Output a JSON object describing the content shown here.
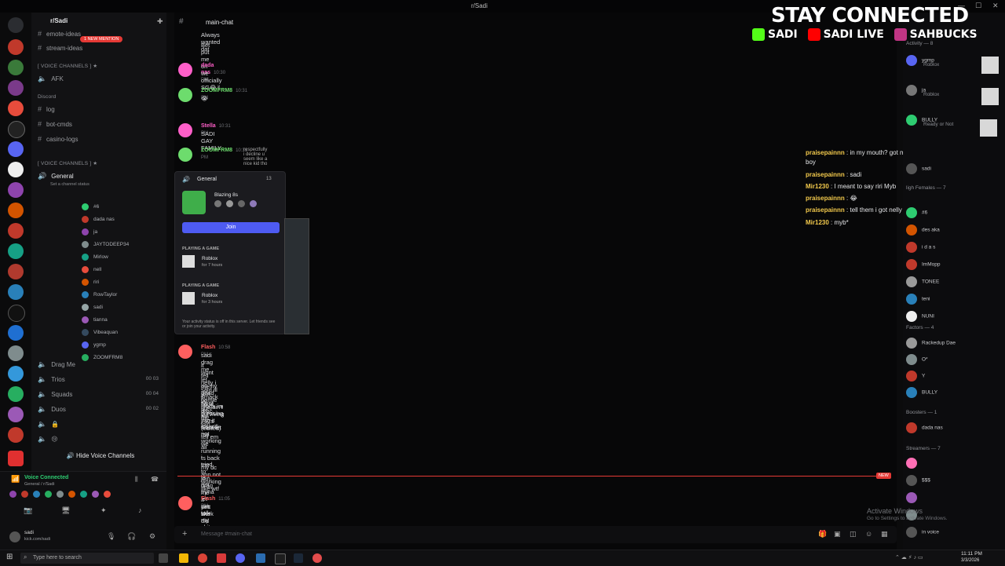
{
  "window": {
    "title": "r/Sadi"
  },
  "server": {
    "name": "r/Sadi"
  },
  "sidebar": {
    "mention_badge": "1 NEW MENTION",
    "top_channels": [
      "emote-ideas",
      "stream-ideas"
    ],
    "voice_category_1": "[ VOICE CHANNELS ] ★",
    "afk": "AFK",
    "discord_category": "Discord",
    "text_channels": [
      "log",
      "bot-cmds",
      "casino-logs"
    ],
    "voice_category_2": "[ VOICE CHANNELS ] ★",
    "general": "General",
    "status_hint": "Set a channel status",
    "members": [
      "#6",
      "dada nas",
      "ja",
      "JAYTODEEP34",
      "Mirlow",
      "nell",
      "riri",
      "RowTaylor",
      "sadi",
      "tianna",
      "Vibeaquan",
      "ygmp",
      "ZOOMFRM8"
    ],
    "voice_channels": [
      {
        "name": "Drag Me",
        "count": ""
      },
      {
        "name": "Trios",
        "count": "00 03"
      },
      {
        "name": "Squads",
        "count": "00 04"
      },
      {
        "name": "Duos",
        "count": "00 02"
      }
    ],
    "hide_voice": "Hide Voice Channels"
  },
  "voice_panel": {
    "status": "Voice Connected",
    "channel": "General / r/Sadi",
    "user": "sadi",
    "sub": "kick.com/sadi"
  },
  "chat": {
    "channel": "main-chat",
    "input_placeholder": "Message #main-chat",
    "messages": [
      {
        "author": "",
        "time": "",
        "lines": [
          "Always wanted dat",
          "Bet put me on"
        ],
        "color": "#dcdde0"
      },
      {
        "author": "dada nas",
        "time": "10:30 PM",
        "lines": [
          "we officially SG😂✌"
        ],
        "color": "#ff5fc9"
      },
      {
        "author": "ZOOMFRM8",
        "time": "10:31 PM",
        "lines": [
          "😭"
        ],
        "color": "#6ddc6d"
      },
      {
        "author": "Stella",
        "time": "10:31 PM",
        "lines": [
          "SADI GAY FAMILY"
        ],
        "color": "#ff5fc9"
      },
      {
        "author": "ZOOMFRM8",
        "time": "10:31 PM",
        "lines": [
          "respectfully i decline u seem like a nice kid tho"
        ],
        "color": "#6ddc6d"
      },
      {
        "author": "Flash",
        "time": "10:58 PM",
        "lines": [
          "sadi drag me",
          "it wont let me join vc",
          "tell nelly i said ill smack ha w drac",
          "on my dead homie she ain't surviving 762s (edited)",
          "it wont let me join",
          "nigga im pressing join it wont let me",
          "aii",
          "it's still not working",
          "tell em we running ts back tmr",
          "aii",
          "i tried to join drag me it aint work",
          "my dc app not working like wtf",
          "ts not tryna let me talk my shit"
        ],
        "color": "#ff5f5f"
      },
      {
        "author": "Flash",
        "time": "11:05 PM",
        "lines": [
          "yes she did"
        ],
        "color": "#ff5f5f"
      }
    ],
    "new_badge": "NEW"
  },
  "popup": {
    "channel": "General",
    "count": "13",
    "activity": "Blazing 8s",
    "join": "Join",
    "sections": [
      {
        "label": "PLAYING A GAME",
        "game": "Roblox",
        "time": "for 7 hours"
      },
      {
        "label": "PLAYING A GAME",
        "game": "Roblox",
        "time": "for 3 hours"
      }
    ],
    "footer": "Your activity status is off in this server. Let friends see or join your activity."
  },
  "overlay_chat": [
    {
      "user": "praisepainnn",
      "text": "in my mouth? got me fucked up ill hurt yu lil ass"
    },
    {
      "user": "",
      "text": "boy"
    },
    {
      "user": "praisepainnn",
      "text": "sadi"
    },
    {
      "user": "Mir1230",
      "text": "I meant to say riri Myb"
    },
    {
      "user": "praisepainnn",
      "text": "😂"
    },
    {
      "user": "praisepainnn",
      "text": "tell them i got nelly onna iso chill on my girl"
    },
    {
      "user": "Mir1230",
      "text": "myb*"
    }
  ],
  "members_panel": {
    "activity_header": "Activity — 8",
    "activity": [
      {
        "name": "ygmp",
        "game": "Roblox",
        "sub": "General"
      },
      {
        "name": "ja",
        "game": "Roblox",
        "sub": "General"
      },
      {
        "name": "BULLY",
        "game": "Ready or Not",
        "sub": "New Player"
      }
    ],
    "online_header": "ligh Females — 7",
    "online": [
      "sadi",
      "#6",
      "des aka",
      "i d a s",
      "ImMopp",
      "TONEE",
      "teni",
      "NUNI"
    ],
    "factors_header": "Factors — 4",
    "factors": [
      "Rackedup Dae",
      "O*",
      "Y",
      "BULLY"
    ],
    "boosters_header": "Boosters — 1",
    "boosters": [
      "dada nas"
    ],
    "streamers_header": "Streamers — 7",
    "streamers": [
      "",
      "$$$",
      "",
      "",
      "in voice"
    ]
  },
  "banner": {
    "title": "STAY CONNECTED",
    "kick": "SADI",
    "youtube": "SADI LIVE",
    "instagram": "SAHBUCKS"
  },
  "watermark": {
    "line1": "Activate Windows",
    "line2": "Go to Settings to activate Windows."
  },
  "taskbar": {
    "search": "Type here to search",
    "time": "11:11 PM",
    "date": "3/3/2026"
  }
}
